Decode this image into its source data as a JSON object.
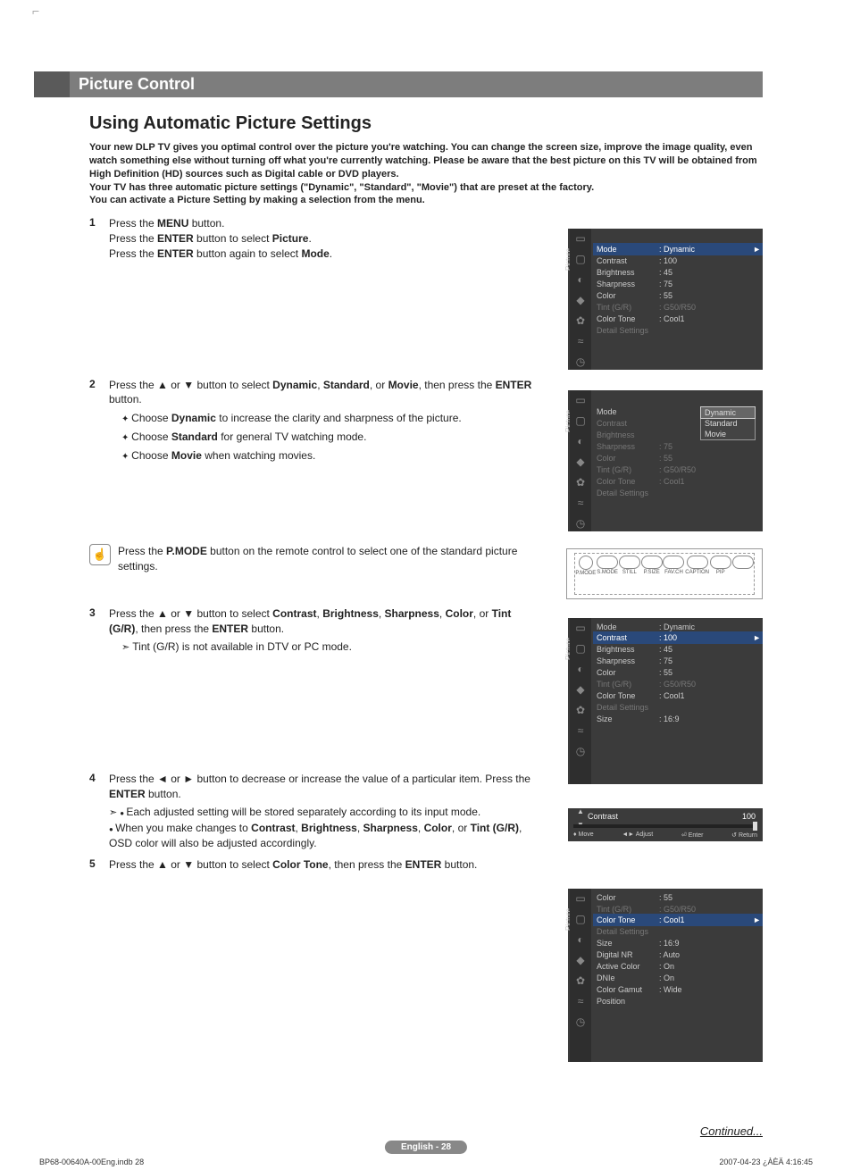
{
  "titlebar": "Picture Control",
  "section_title": "Using Automatic Picture Settings",
  "intro": "Your new DLP TV gives you optimal control over the picture you're watching.  You can change the screen size, improve the image quality, even watch something else without turning off what you're currently watching. Please be aware that the best picture on this TV will be obtained from High Definition (HD) sources such as Digital cable or DVD players.\nYour TV has three automatic picture settings (\"Dynamic\", \"Standard\", \"Movie\") that are preset at the factory.\nYou can activate a Picture Setting by making a selection from the menu.",
  "steps": {
    "s1": {
      "num": "1",
      "l1": "Press the MENU button.",
      "l2": "Press the ENTER button to select Picture.",
      "l3": "Press the ENTER button again to select Mode."
    },
    "s2": {
      "num": "2",
      "main": "Press the ▲ or ▼ button to select Dynamic, Standard, or Movie, then press the ENTER button.",
      "b1": "Choose Dynamic to increase the clarity and sharpness of the picture.",
      "b2": "Choose Standard for general TV watching mode.",
      "b3": "Choose Movie when watching movies."
    },
    "s3": {
      "num": "3",
      "main": "Press the ▲ or ▼ button to select Contrast, Brightness, Sharpness, Color, or Tint (G/R), then press the ENTER button.",
      "note": "Tint (G/R) is not available in DTV or PC mode."
    },
    "s4": {
      "num": "4",
      "main": "Press the ◄ or ► button to decrease or increase the value of a particular item. Press the ENTER button.",
      "n1": "Each adjusted setting will be stored separately according to its input mode.",
      "n2": "When you make changes to Contrast, Brightness, Sharpness, Color, or Tint (G/R), OSD color will also be adjusted accordingly."
    },
    "s5": {
      "num": "5",
      "main": "Press the ▲ or ▼ button to select Color Tone, then press the ENTER button."
    }
  },
  "tip": "Press the P.MODE button on the remote control to select one of the standard picture settings.",
  "osd_common": {
    "side_label": "Picture"
  },
  "osd1": {
    "rows": [
      {
        "k": "Mode",
        "v": "Dynamic",
        "hl": true
      },
      {
        "k": "Contrast",
        "v": "100"
      },
      {
        "k": "Brightness",
        "v": "45"
      },
      {
        "k": "Sharpness",
        "v": "75"
      },
      {
        "k": "Color",
        "v": "55"
      },
      {
        "k": "Tint (G/R)",
        "v": "G50/R50",
        "dim": true
      },
      {
        "k": "Color Tone",
        "v": "Cool1"
      },
      {
        "k": "Detail Settings",
        "v": "",
        "dim": true
      }
    ]
  },
  "osd2": {
    "rows": [
      {
        "k": "Mode",
        "v": ""
      },
      {
        "k": "Contrast",
        "v": "",
        "dim": true
      },
      {
        "k": "Brightness",
        "v": "",
        "dim": true
      },
      {
        "k": "Sharpness",
        "v": "75",
        "dim": true
      },
      {
        "k": "Color",
        "v": "55",
        "dim": true
      },
      {
        "k": "Tint (G/R)",
        "v": "G50/R50",
        "dim": true
      },
      {
        "k": "Color Tone",
        "v": "Cool1",
        "dim": true
      },
      {
        "k": "Detail Settings",
        "v": "",
        "dim": true
      }
    ],
    "drop": [
      "Dynamic",
      "Standard",
      "Movie"
    ],
    "drop_sel": 0
  },
  "osd3": {
    "rows": [
      {
        "k": "Mode",
        "v": "Dynamic"
      },
      {
        "k": "Contrast",
        "v": "100",
        "hl": true
      },
      {
        "k": "Brightness",
        "v": "45"
      },
      {
        "k": "Sharpness",
        "v": "75"
      },
      {
        "k": "Color",
        "v": "55"
      },
      {
        "k": "Tint (G/R)",
        "v": "G50/R50",
        "dim": true
      },
      {
        "k": "Color Tone",
        "v": "Cool1"
      },
      {
        "k": "Detail Settings",
        "v": "",
        "dim": true
      },
      {
        "k": "Size",
        "v": "16:9"
      }
    ]
  },
  "osd4": {
    "rows": [
      {
        "k": "Color",
        "v": "55"
      },
      {
        "k": "Tint (G/R)",
        "v": "G50/R50",
        "dim": true
      },
      {
        "k": "Color Tone",
        "v": "Cool1",
        "hl": true
      },
      {
        "k": "Detail Settings",
        "v": "",
        "dim": true
      },
      {
        "k": "Size",
        "v": "16:9"
      },
      {
        "k": "Digital NR",
        "v": "Auto"
      },
      {
        "k": "Active Color",
        "v": "On"
      },
      {
        "k": "DNIe",
        "v": "On"
      },
      {
        "k": "Color Gamut",
        "v": "Wide"
      },
      {
        "k": "Position",
        "v": ""
      }
    ]
  },
  "remote": {
    "top": [
      "P.MODE",
      "S.MODE",
      "STILL",
      "P.SIZE"
    ],
    "bot": [
      "FAV.CH",
      "CAPTION",
      "PIP",
      ""
    ]
  },
  "slider": {
    "title": "Contrast",
    "value": "100",
    "foot": {
      "move": "Move",
      "adjust": "Adjust",
      "enter": "Enter",
      "ret": "Return"
    }
  },
  "continued": "Continued...",
  "pageno": "English - 28",
  "foot_left": "BP68-00640A-00Eng.indb   28",
  "foot_right": "2007-04-23   ¿ÀÈÄ 4:16:45"
}
